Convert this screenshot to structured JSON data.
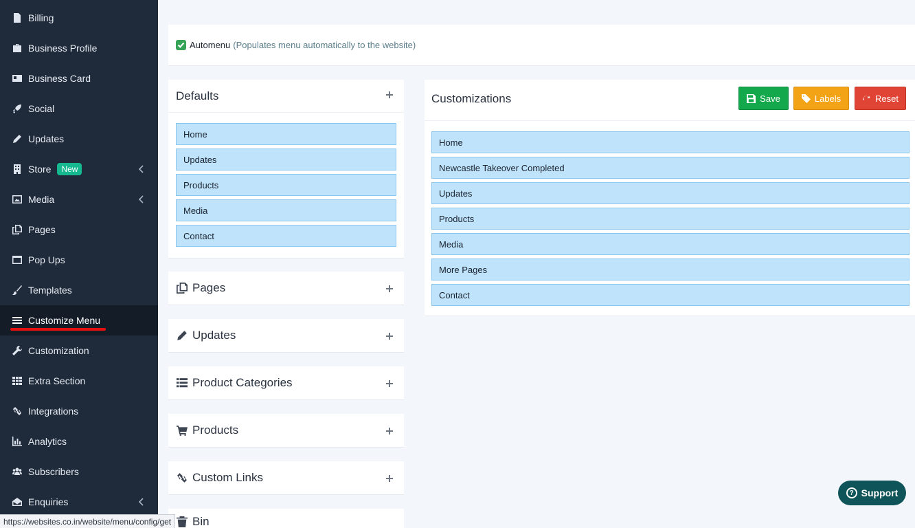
{
  "sidebar": {
    "items": [
      {
        "label": "Billing",
        "icon": "file-icon"
      },
      {
        "label": "Business Profile",
        "icon": "briefcase-icon"
      },
      {
        "label": "Business Card",
        "icon": "id-card-icon"
      },
      {
        "label": "Social",
        "icon": "rocket-icon"
      },
      {
        "label": "Updates",
        "icon": "pencil-icon"
      },
      {
        "label": "Store",
        "icon": "building-icon",
        "badge": "New",
        "has_submenu": true
      },
      {
        "label": "Media",
        "icon": "image-icon",
        "has_submenu": true
      },
      {
        "label": "Pages",
        "icon": "copy-icon"
      },
      {
        "label": "Pop Ups",
        "icon": "window-icon"
      },
      {
        "label": "Templates",
        "icon": "brush-icon"
      },
      {
        "label": "Customize Menu",
        "icon": "bars-icon",
        "active": true
      },
      {
        "label": "Customization",
        "icon": "wrench-icon"
      },
      {
        "label": "Extra Section",
        "icon": "grid-icon"
      },
      {
        "label": "Integrations",
        "icon": "link-icon"
      },
      {
        "label": "Analytics",
        "icon": "bar-chart-icon"
      },
      {
        "label": "Subscribers",
        "icon": "users-icon"
      },
      {
        "label": "Enquiries",
        "icon": "envelope-open-icon",
        "has_submenu": true
      }
    ]
  },
  "automenu": {
    "checked": true,
    "label": "Automenu",
    "hint": "(Populates menu automatically to the website)"
  },
  "defaults": {
    "title": "Defaults",
    "items": [
      "Home",
      "Updates",
      "Products",
      "Media",
      "Contact"
    ]
  },
  "collapsed_panels": [
    {
      "title": "Pages",
      "icon": "copy-icon"
    },
    {
      "title": "Updates",
      "icon": "pencil-icon"
    },
    {
      "title": "Product Categories",
      "icon": "list-icon"
    },
    {
      "title": "Products",
      "icon": "cart-icon"
    },
    {
      "title": "Custom Links",
      "icon": "link-icon"
    },
    {
      "title": "Bin",
      "icon": "trash-icon"
    }
  ],
  "customizations": {
    "title": "Customizations",
    "items": [
      "Home",
      "Newcastle Takeover Completed",
      "Updates",
      "Products",
      "Media",
      "More Pages",
      "Contact"
    ],
    "buttons": {
      "save": "Save",
      "labels": "Labels",
      "reset": "Reset"
    }
  },
  "support": {
    "label": "Support"
  },
  "status_url": "https://websites.co.in/website/menu/config/get",
  "colors": {
    "sidebar_bg": "#1f2a3a",
    "menu_item_bg": "#bfe3fa",
    "save": "#14a84d",
    "labels": "#f3a316",
    "reset": "#df4434",
    "badge": "#16b890",
    "support": "#0f5458"
  }
}
